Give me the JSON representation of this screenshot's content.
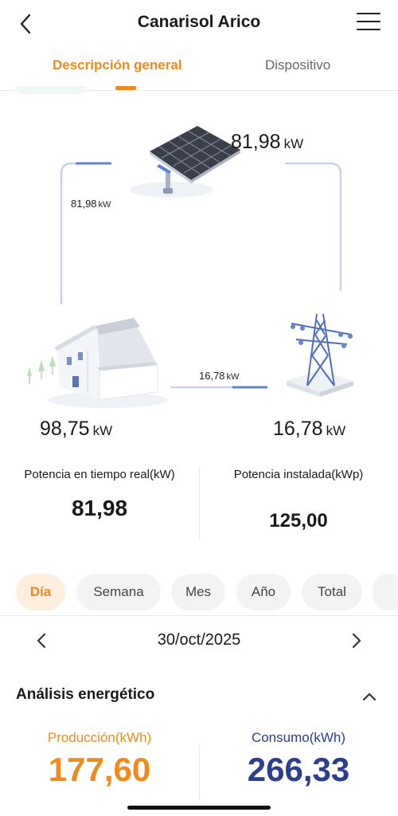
{
  "header": {
    "title": "Canarisol Arico",
    "back_icon": "chevron-left-icon",
    "menu_icon": "hamburger-menu-icon"
  },
  "tabs": [
    {
      "label": "Descripción general",
      "active": true
    },
    {
      "label": "Dispositivo",
      "active": false
    }
  ],
  "flow": {
    "solar": {
      "value": "81,98",
      "unit": "kW"
    },
    "solar_to_home": {
      "value": "81,98",
      "unit": "kW"
    },
    "home": {
      "value": "98,75",
      "unit": "kW"
    },
    "grid_to_home": {
      "value": "16,78",
      "unit": "kW"
    },
    "grid": {
      "value": "16,78",
      "unit": "kW"
    }
  },
  "stats": {
    "realtime": {
      "label": "Potencia en tiempo real(kW)",
      "value": "81,98"
    },
    "installed": {
      "label": "Potencia instalada(kWp)",
      "value": "125,00"
    }
  },
  "periods": [
    {
      "label": "Día",
      "active": true
    },
    {
      "label": "Semana",
      "active": false
    },
    {
      "label": "Mes",
      "active": false
    },
    {
      "label": "Año",
      "active": false
    },
    {
      "label": "Total",
      "active": false
    }
  ],
  "date_nav": {
    "date": "30/oct/2025"
  },
  "analysis": {
    "title": "Análisis energético",
    "production": {
      "label": "Producción(kWh)",
      "value": "177,60"
    },
    "consumption": {
      "label": "Consumo(kWh)",
      "value": "266,33"
    }
  },
  "colors": {
    "accent": "#f08a1c",
    "consumption": "#2b3f8c",
    "flow_line": "#c7d3ee",
    "flow_active": "#5b84d6"
  }
}
